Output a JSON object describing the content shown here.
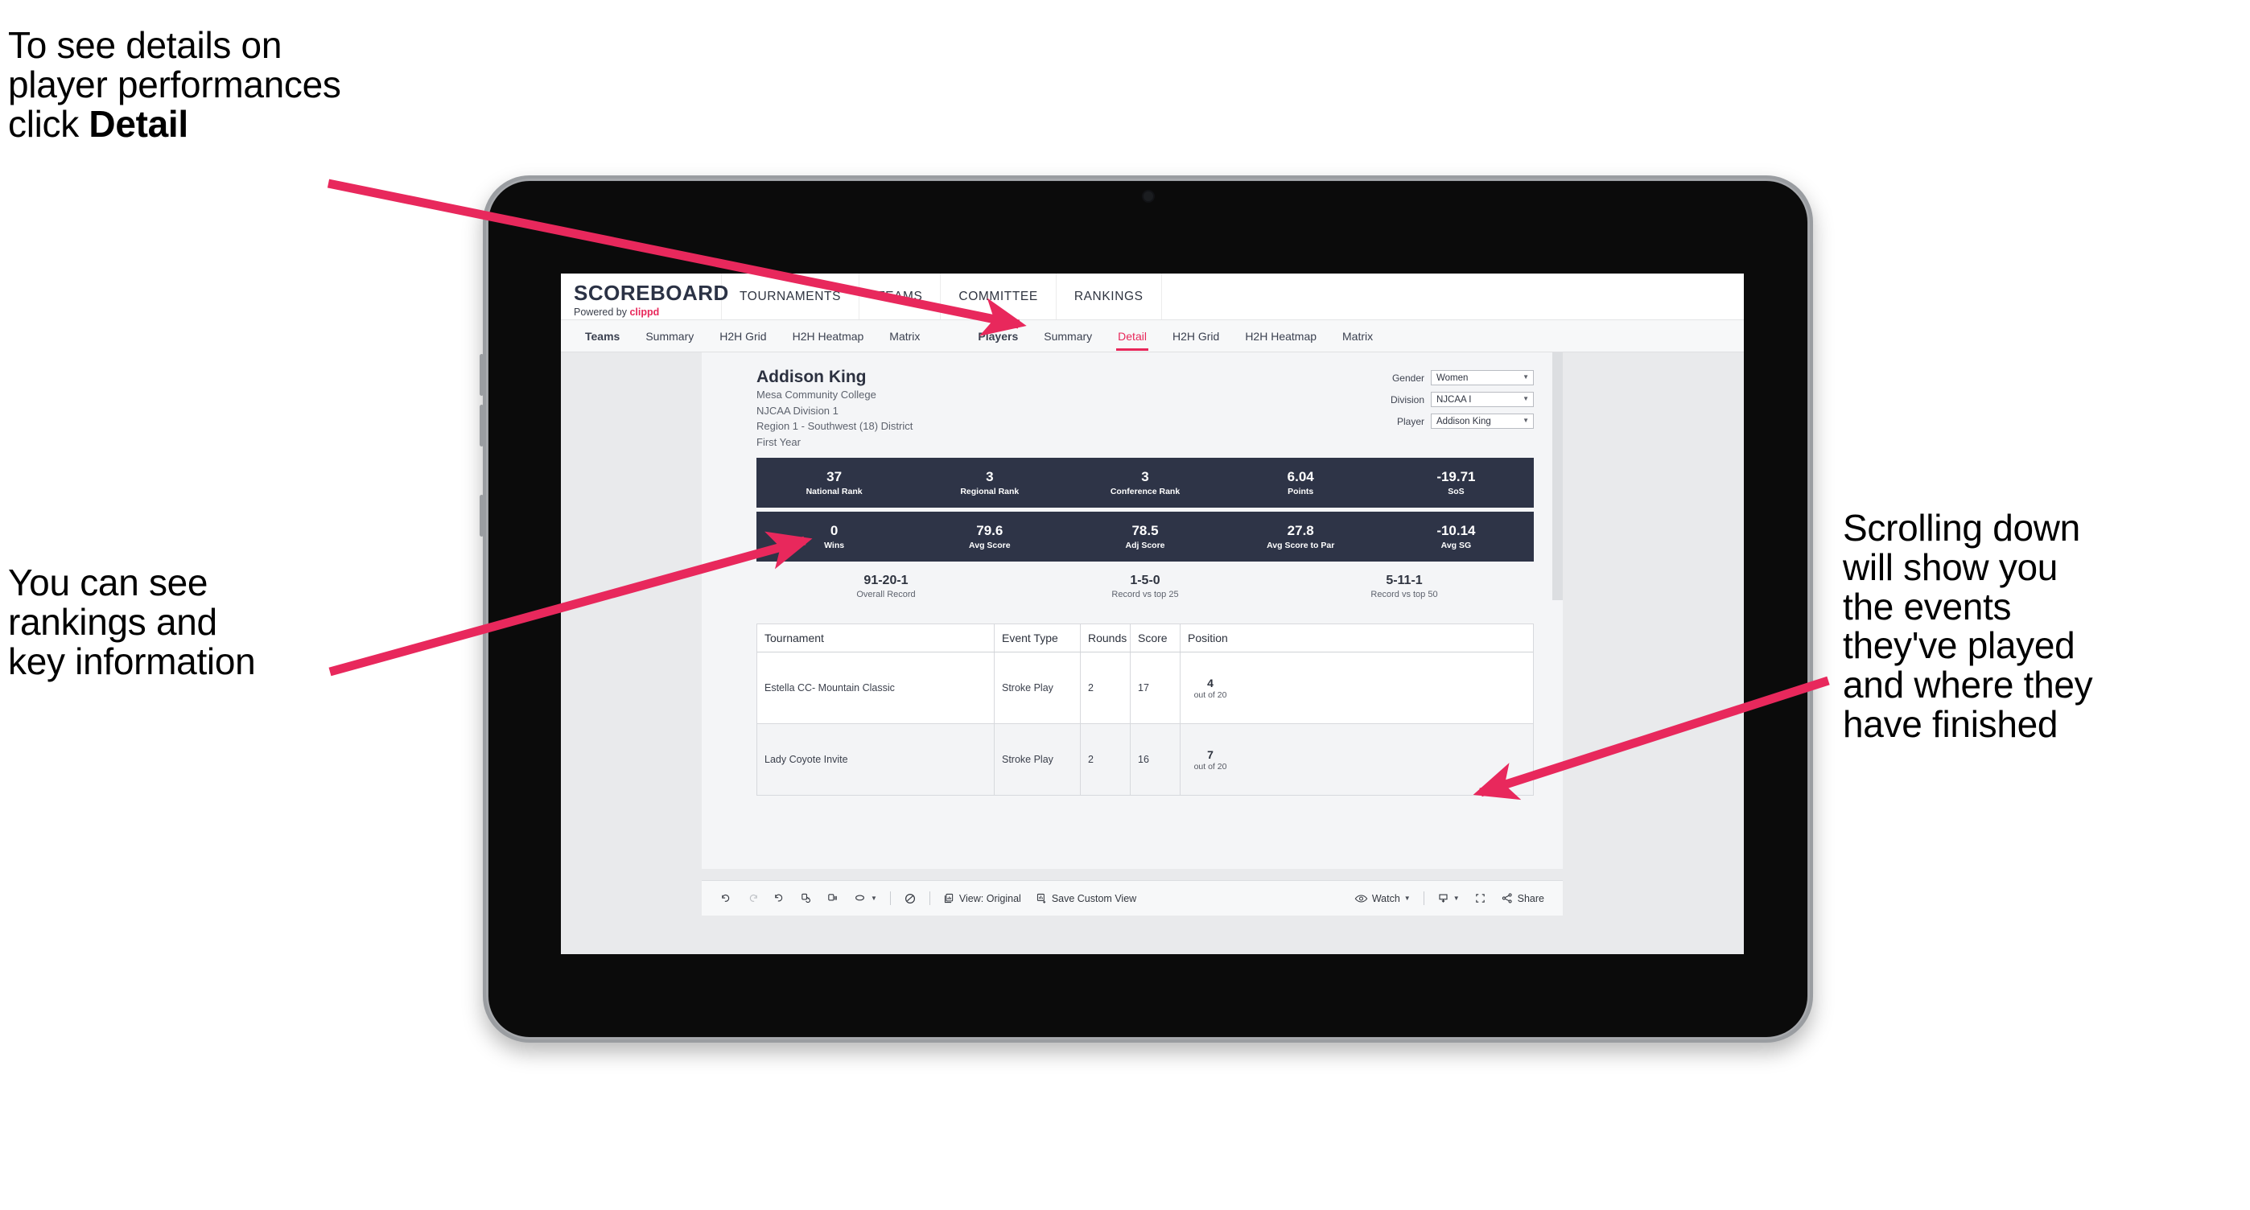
{
  "annotations": {
    "detail_note": "To see details on\nplayer performances\nclick ",
    "detail_note_bold": "Detail",
    "rankings_note": "You can see\nrankings and\nkey information",
    "scroll_note": "Scrolling down\nwill show you\nthe events\nthey've played\nand where they\nhave finished",
    "arrow_color": "#e8285c"
  },
  "app": {
    "logo_title": "SCOREBOARD",
    "logo_sub_prefix": "Powered by ",
    "logo_brand": "clippd",
    "main_nav": [
      "TOURNAMENTS",
      "TEAMS",
      "COMMITTEE",
      "RANKINGS"
    ],
    "team_tabs": [
      "Teams",
      "Summary",
      "H2H Grid",
      "H2H Heatmap",
      "Matrix"
    ],
    "player_tabs": [
      "Players",
      "Summary",
      "Detail",
      "H2H Grid",
      "H2H Heatmap",
      "Matrix"
    ],
    "active_tab": "Detail"
  },
  "player": {
    "name": "Addison King",
    "college": "Mesa Community College",
    "division": "NJCAA Division 1",
    "region": "Region 1 - Southwest (18) District",
    "year": "First Year"
  },
  "filters": [
    {
      "label": "Gender",
      "value": "Women"
    },
    {
      "label": "Division",
      "value": "NJCAA I"
    },
    {
      "label": "Player",
      "value": "Addison King"
    }
  ],
  "stats_row_1": [
    {
      "value": "37",
      "label": "National Rank"
    },
    {
      "value": "3",
      "label": "Regional Rank"
    },
    {
      "value": "3",
      "label": "Conference Rank"
    },
    {
      "value": "6.04",
      "label": "Points"
    },
    {
      "value": "-19.71",
      "label": "SoS"
    }
  ],
  "stats_row_2": [
    {
      "value": "0",
      "label": "Wins"
    },
    {
      "value": "79.6",
      "label": "Avg Score"
    },
    {
      "value": "78.5",
      "label": "Adj Score"
    },
    {
      "value": "27.8",
      "label": "Avg Score to Par"
    },
    {
      "value": "-10.14",
      "label": "Avg SG"
    }
  ],
  "records": [
    {
      "value": "91-20-1",
      "label": "Overall Record"
    },
    {
      "value": "1-5-0",
      "label": "Record vs top 25"
    },
    {
      "value": "5-11-1",
      "label": "Record vs top 50"
    }
  ],
  "table": {
    "columns": [
      "Tournament",
      "Event Type",
      "Rounds",
      "Score",
      "Position"
    ],
    "rows": [
      {
        "tournament": "Estella CC- Mountain Classic",
        "event_type": "Stroke Play",
        "rounds": "2",
        "score": "17",
        "position": "4",
        "position_sub": "out of 20"
      },
      {
        "tournament": "Lady Coyote Invite",
        "event_type": "Stroke Play",
        "rounds": "2",
        "score": "16",
        "position": "7",
        "position_sub": "out of 20"
      }
    ]
  },
  "toolbar": {
    "view_label": "View: Original",
    "save_label": "Save Custom View",
    "watch_label": "Watch",
    "share_label": "Share"
  },
  "colors": {
    "accent_pink": "#e8275a",
    "stat_navy": "#2e3447",
    "canvas_gray": "#e9eaec"
  }
}
